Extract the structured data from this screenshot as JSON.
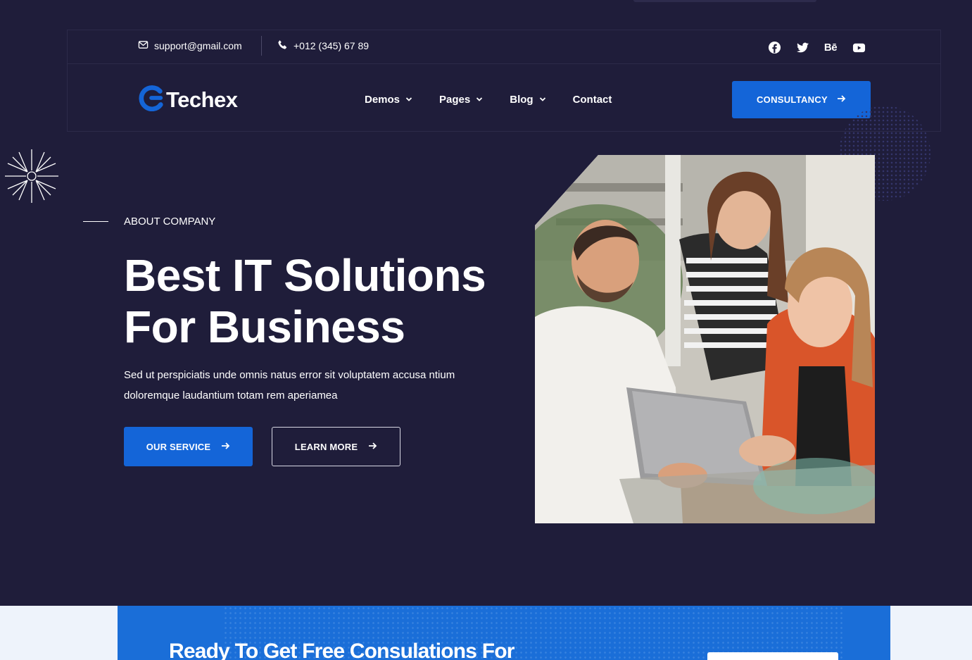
{
  "topbar": {
    "email": "support@gmail.com",
    "phone": "+012 (345) 67 89",
    "socials": [
      "facebook-icon",
      "twitter-icon",
      "behance-icon",
      "youtube-icon"
    ],
    "behance_label": "Bē"
  },
  "brand": {
    "name": "Techex",
    "accent": "#1465d8",
    "background": "#1f1d3a"
  },
  "nav": {
    "items": [
      {
        "label": "Demos",
        "dropdown": true
      },
      {
        "label": "Pages",
        "dropdown": true
      },
      {
        "label": "Blog",
        "dropdown": true
      },
      {
        "label": "Contact",
        "dropdown": false
      }
    ],
    "cta_label": "CONSULTANCY"
  },
  "hero": {
    "eyebrow": "ABOUT COMPANY",
    "title_line1": "Best IT Solutions",
    "title_line2": "For Business",
    "description_line1": "Sed ut perspiciatis unde omnis natus error sit voluptatem accusa ntium",
    "description_line2": "doloremque laudantium totam rem aperiamea",
    "primary_button": "OUR SERVICE",
    "secondary_button": "LEARN MORE"
  },
  "cta_banner": {
    "title": "Ready To Get Free Consulations For"
  }
}
